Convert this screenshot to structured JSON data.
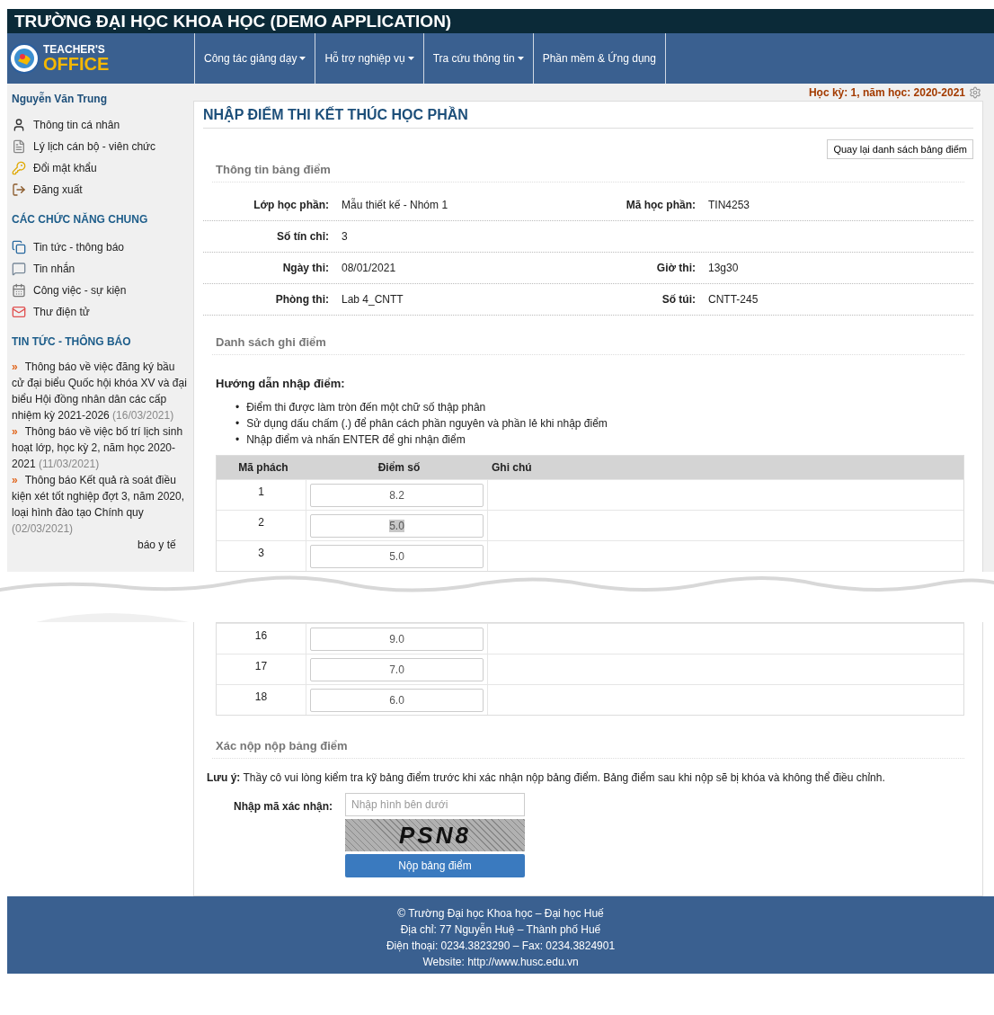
{
  "app_title": "TRƯỜNG ĐẠI HỌC KHOA HỌC (DEMO APPLICATION)",
  "logo": {
    "line_1": "TEACHER'S",
    "line_2": "OFFICE"
  },
  "nav": [
    {
      "label": "Công tác giảng dạy",
      "has_menu": true
    },
    {
      "label": "Hỗ trợ nghiệp vụ",
      "has_menu": true
    },
    {
      "label": "Tra cứu thông tin",
      "has_menu": true
    },
    {
      "label": "Phần mềm & Ứng dụng",
      "has_menu": false
    }
  ],
  "semester": "Học kỳ: 1, năm học: 2020-2021",
  "sidebar": {
    "user": "Nguyễn Văn Trung",
    "user_links": [
      "Thông tin cá nhân",
      "Lý lịch cán bộ - viên chức",
      "Đổi mật khẩu",
      "Đăng xuất"
    ],
    "common_title": "CÁC CHỨC NĂNG CHUNG",
    "common_links": [
      "Tin tức - thông báo",
      "Tin nhắn",
      "Công việc - sự kiện",
      "Thư điện tử"
    ],
    "news_title": "TIN TỨC - THÔNG BÁO",
    "news": [
      {
        "marker": "»",
        "text": "Thông báo về việc đăng ký bầu cử đại biểu Quốc hội khóa XV và đại biểu Hội đồng nhân dân các cấp nhiệm kỳ 2021-2026",
        "date": "(16/03/2021)"
      },
      {
        "marker": "»",
        "text": "Thông báo về việc bố trí lịch sinh hoạt lớp, học kỳ 2, năm học 2020-2021",
        "date": "(11/03/2021)"
      },
      {
        "marker": "»",
        "text": "Thông báo Kết quả rà soát điều kiện xét tốt nghiệp đợt 3, năm 2020, loại hình đào tạo Chính quy",
        "date": "(02/03/2021)"
      }
    ],
    "news_fragment": "báo y tế"
  },
  "page_title": "NHẬP ĐIỂM THI KẾT THÚC HỌC PHẦN",
  "back_button": "Quay lại danh sách bảng điểm",
  "info_title": "Thông tin bảng điểm",
  "info_rows": [
    {
      "label": "Lớp học phần:",
      "value": "Mẫu thiết kế - Nhóm 1",
      "label_2": "Mã học phần:",
      "value_2": "TIN4253"
    },
    {
      "label": "Số tín chỉ:",
      "value": "3"
    },
    {
      "label": "Ngày thi:",
      "value": "08/01/2021",
      "label_2": "Giờ thi:",
      "value_2": "13g30"
    },
    {
      "label": "Phòng thi:",
      "value": "Lab 4_CNTT",
      "label_2": "Số túi:",
      "value_2": "CNTT-245"
    }
  ],
  "list_title": "Danh sách ghi điểm",
  "guide_title": "Hướng dẫn nhập điểm:",
  "guide": [
    {
      "marker": "•",
      "text": "Điểm thi được làm tròn đến một chữ số thập phân"
    },
    {
      "marker": "•",
      "text": "Sử dụng dấu chấm (.) để phân cách phần nguyên và phần lẻ khi nhập điểm"
    },
    {
      "marker": "•",
      "text": "Nhập điểm và nhấn ENTER để ghi nhận điểm"
    }
  ],
  "table": {
    "columns": [
      "Mã phách",
      "Điểm số",
      "Ghi chú"
    ],
    "rows_top": [
      {
        "code": "1",
        "score": "8.2",
        "highlighted": false
      },
      {
        "code": "2",
        "score": "5.0",
        "highlighted": true
      },
      {
        "code": "3",
        "score": "5.0",
        "highlighted": false
      }
    ],
    "rows_bottom": [
      {
        "code": "16",
        "score": "9.0",
        "highlighted": false
      },
      {
        "code": "17",
        "score": "7.0",
        "highlighted": false
      },
      {
        "code": "18",
        "score": "6.0",
        "highlighted": false
      }
    ]
  },
  "submit_title": "Xác nộp nộp bảng điểm",
  "note": "**Lưu ý:** Thầy cô vui lòng kiểm tra kỹ bảng điểm trước khi xác nhận nộp bảng điểm. Bảng điểm sau khi nộp sẽ bị khóa và không thể điều chỉnh.",
  "captcha_label": "Nhập mã xác nhận:",
  "captcha_placeholder": "Nhập hình bên dưới",
  "captcha_text": "PSN8",
  "submit_button": "Nộp bảng điểm",
  "footer": [
    "© Trường Đại học Khoa học – Đại học Huế",
    "Địa chỉ: 77 Nguyễn Huệ – Thành phố Huế",
    "Điện thoại: 0234.3823290 – Fax: 0234.3824901",
    "Website: http://www.husc.edu.vn"
  ]
}
